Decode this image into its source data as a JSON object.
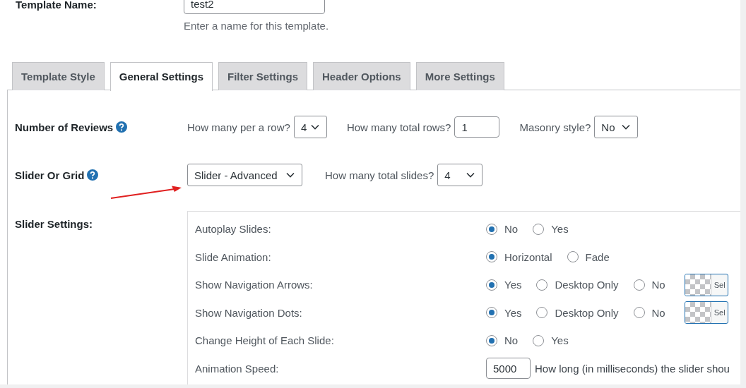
{
  "template_name": {
    "label": "Template Name:",
    "value": "test2",
    "description": "Enter a name for this template."
  },
  "tabs": [
    {
      "label": "Template Style",
      "selected": false
    },
    {
      "label": "General Settings",
      "selected": true
    },
    {
      "label": "Filter Settings",
      "selected": false
    },
    {
      "label": "Header Options",
      "selected": false
    },
    {
      "label": "More Settings",
      "selected": false
    }
  ],
  "number_of_reviews": {
    "label": "Number of Reviews",
    "per_row_label": "How many per a row?",
    "per_row": "4",
    "total_rows_label": "How many total rows?",
    "total_rows": "1",
    "masonry_label": "Masonry style?",
    "masonry": "No"
  },
  "slider_or_grid": {
    "label": "Slider Or Grid",
    "value": "Slider - Advanced",
    "total_slides_label": "How many total slides?",
    "total_slides": "4"
  },
  "slider_settings": {
    "label": "Slider Settings:",
    "rows": [
      {
        "kind": "radio",
        "label": "Autoplay Slides:",
        "options": [
          {
            "label": "No",
            "selected": true
          },
          {
            "label": "Yes",
            "selected": false
          }
        ]
      },
      {
        "kind": "radio",
        "label": "Slide Animation:",
        "options": [
          {
            "label": "Horizontal",
            "selected": true
          },
          {
            "label": "Fade",
            "selected": false
          }
        ]
      },
      {
        "kind": "radio",
        "label": "Show Navigation Arrows:",
        "options": [
          {
            "label": "Yes",
            "selected": true
          },
          {
            "label": "Desktop Only",
            "selected": false
          },
          {
            "label": "No",
            "selected": false
          }
        ],
        "color_button": "Sel"
      },
      {
        "kind": "radio",
        "label": "Show Navigation Dots:",
        "options": [
          {
            "label": "Yes",
            "selected": true
          },
          {
            "label": "Desktop Only",
            "selected": false
          },
          {
            "label": "No",
            "selected": false
          }
        ],
        "color_button": "Sel"
      },
      {
        "kind": "radio",
        "label": "Change Height of Each Slide:",
        "options": [
          {
            "label": "No",
            "selected": true
          },
          {
            "label": "Yes",
            "selected": false
          }
        ]
      },
      {
        "kind": "number",
        "label": "Animation Speed:",
        "value": "5000",
        "description": "How long (in milliseconds) the slider shou"
      }
    ]
  }
}
